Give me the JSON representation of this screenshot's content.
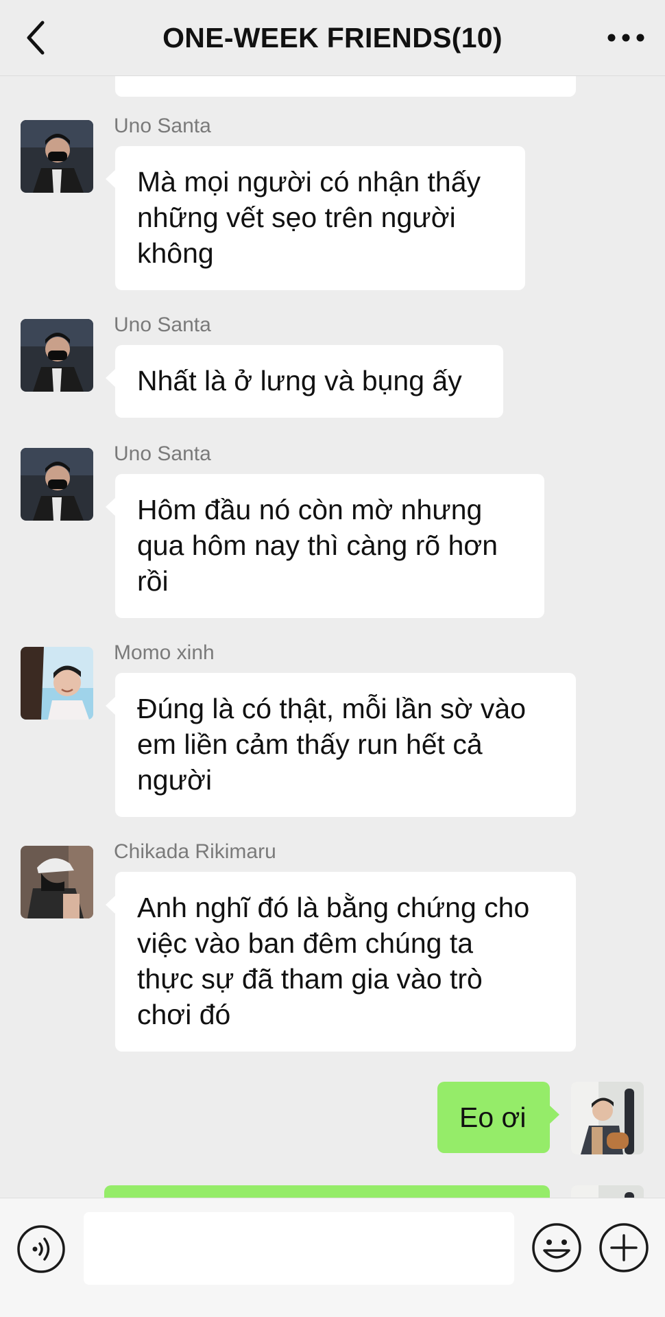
{
  "header": {
    "title": "ONE-WEEK FRIENDS(10)",
    "back_icon": "chevron-left-icon",
    "more_icon": "more-dots-icon"
  },
  "messages": [
    {
      "sender": "Uno Santa",
      "side": "left",
      "lines": [
        "Mà mọi người có nhận thấy",
        "những vết sẹo trên người",
        "không"
      ]
    },
    {
      "sender": "Uno Santa",
      "side": "left",
      "lines": [
        "Nhất là ở lưng và bụng ấy"
      ]
    },
    {
      "sender": "Uno Santa",
      "side": "left",
      "lines": [
        "Hôm đầu nó còn mờ nhưng",
        "qua hôm nay thì càng rõ hơn",
        "rồi"
      ]
    },
    {
      "sender": "Momo xinh",
      "side": "left",
      "lines": [
        "Đúng là có thật, mỗi lần sờ vào",
        "em liền cảm thấy run hết cả",
        "người"
      ]
    },
    {
      "sender": "Chikada Rikimaru",
      "side": "left",
      "lines": [
        "Anh nghĩ đó là bằng chứng cho",
        "việc vào ban đêm chúng ta",
        "thực sự đã tham gia vào trò",
        "chơi đó"
      ]
    },
    {
      "sender": "",
      "side": "right",
      "lines": [
        "Eo ơi"
      ]
    }
  ],
  "input_bar": {
    "voice_icon": "voice-icon",
    "emoji_icon": "emoji-icon",
    "plus_icon": "plus-icon",
    "text_value": ""
  },
  "colors": {
    "background": "#ededed",
    "bubble_received": "#ffffff",
    "bubble_sent": "#95ec69",
    "sender_name": "#7a7a7a"
  }
}
